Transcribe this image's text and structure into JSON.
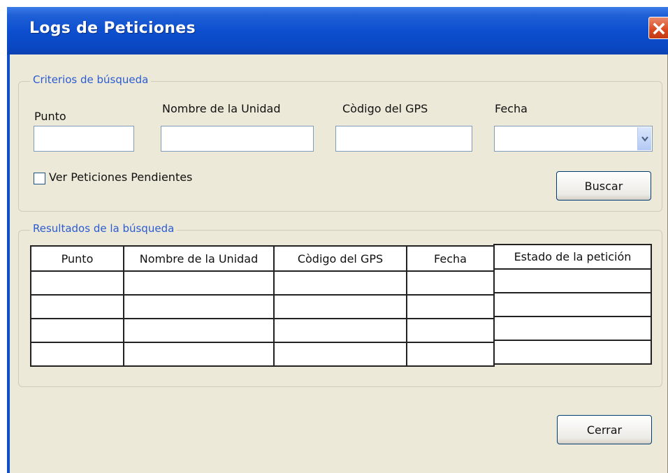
{
  "window": {
    "title": "Logs de Peticiones"
  },
  "search_criteria": {
    "legend": "Criterios de búsqueda",
    "punto_label": "Punto",
    "punto_value": "",
    "unidad_label": "Nombre de la Unidad",
    "unidad_value": "",
    "gps_label": "Còdigo del GPS",
    "gps_value": "",
    "fecha_label": "Fecha",
    "fecha_value": "",
    "pending_label": "Ver Peticiones Pendientes",
    "search_button": "Buscar"
  },
  "results": {
    "legend": "Resultados de la búsqueda",
    "columns": [
      "Punto",
      "Nombre de la Unidad",
      "Còdigo del GPS",
      "Fecha",
      "Estado de la petición"
    ],
    "rows": [
      [
        "",
        "",
        "",
        "",
        ""
      ],
      [
        "",
        "",
        "",
        "",
        ""
      ],
      [
        "",
        "",
        "",
        "",
        ""
      ],
      [
        "",
        "",
        "",
        "",
        ""
      ]
    ]
  },
  "footer": {
    "close_button": "Cerrar"
  },
  "icons": {
    "close": "close-icon",
    "dropdown": "chevron-down-icon"
  },
  "colors": {
    "titlebar": "#0a47c2",
    "window_bg": "#ede9d8",
    "legend_text": "#2a5bd0",
    "close_button": "#d9481f"
  }
}
